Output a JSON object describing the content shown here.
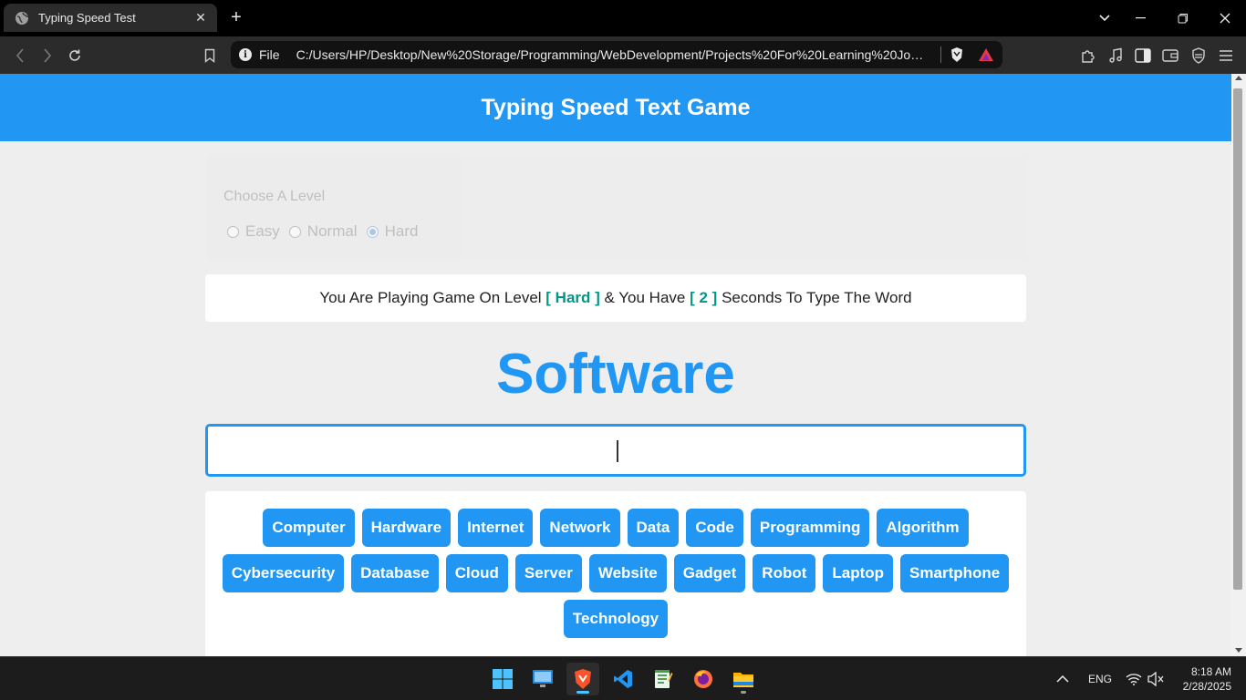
{
  "browser": {
    "tab_title": "Typing Speed Test",
    "new_tab_symbol": "+",
    "address_scheme": "File",
    "address_url": "C:/Users/HP/Desktop/New%20Storage/Programming/WebDevelopment/Projects%20For%20Learning%20Journey/..."
  },
  "page": {
    "header_title": "Typing Speed Text Game",
    "level_chooser": {
      "title": "Choose A Level",
      "options": [
        {
          "label": "Easy",
          "checked": false
        },
        {
          "label": "Normal",
          "checked": false
        },
        {
          "label": "Hard",
          "checked": true
        }
      ]
    },
    "message": {
      "part1": "You Are Playing Game On Level ",
      "level": "[ Hard ]",
      "part2": " & You Have ",
      "seconds": "[ 2 ]",
      "part3": " Seconds To Type The Word"
    },
    "current_word": "Software",
    "input": {
      "value": "",
      "placeholder": ""
    },
    "upcoming_words": [
      "Computer",
      "Hardware",
      "Internet",
      "Network",
      "Data",
      "Code",
      "Programming",
      "Algorithm",
      "Cybersecurity",
      "Database",
      "Cloud",
      "Server",
      "Website",
      "Gadget",
      "Robot",
      "Laptop",
      "Smartphone",
      "Technology"
    ]
  },
  "taskbar": {
    "apps": [
      "windows-start",
      "desktop",
      "brave-browser",
      "vs-code",
      "notepad",
      "firefox",
      "file-explorer"
    ],
    "language": "ENG",
    "time": "8:18 AM",
    "date": "2/28/2025"
  },
  "colors": {
    "accent": "#2196f3",
    "highlight": "#009688",
    "page_background": "#eeeeee"
  }
}
